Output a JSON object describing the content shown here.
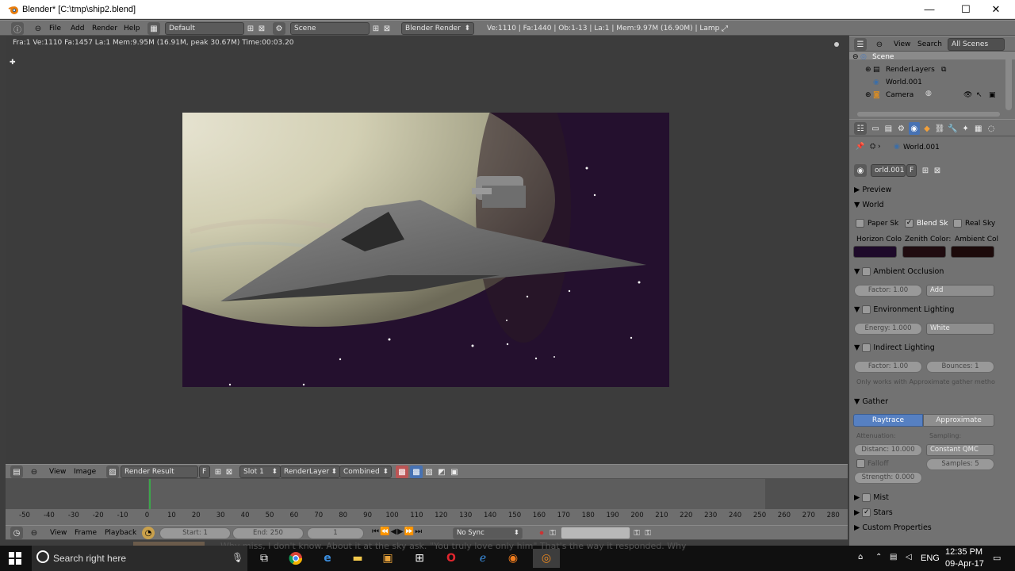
{
  "window": {
    "title": "Blender* [C:\\tmp\\ship2.blend]",
    "minimize": "—",
    "maximize": "☐",
    "close": "✕"
  },
  "info_header": {
    "menus": [
      "File",
      "Add",
      "Render",
      "Help"
    ],
    "layout": "Default",
    "scene": "Scene",
    "engine": "Blender Render",
    "stats": "Ve:1110 | Fa:1440 | Ob:1-13 | La:1 | Mem:9.97M (16.90M) | Lamp"
  },
  "viewport": {
    "render_stats": "Fra:1  Ve:1110 Fa:1457 La:1 Mem:9.95M (16.91M, peak 30.67M) Time:00:03.20"
  },
  "image_header": {
    "view": "View",
    "image": "Image",
    "image_name": "Render Result",
    "fake_user": "F",
    "slot": "Slot 1",
    "layer": "RenderLayer",
    "pass": "Combined"
  },
  "timeline": {
    "ticks": [
      "-50",
      "-40",
      "-30",
      "-20",
      "-10",
      "0",
      "10",
      "20",
      "30",
      "40",
      "50",
      "60",
      "70",
      "80",
      "90",
      "100",
      "110",
      "120",
      "130",
      "140",
      "150",
      "160",
      "170",
      "180",
      "190",
      "200",
      "210",
      "220",
      "230",
      "240",
      "250",
      "260",
      "270",
      "280"
    ],
    "current_frame_value": 1,
    "menus": [
      "View",
      "Frame",
      "Playback"
    ],
    "start": "Start: 1",
    "end": "End: 250",
    "frame": "1",
    "sync": "No Sync"
  },
  "outliner": {
    "view": "View",
    "search": "Search",
    "filter": "All Scenes",
    "items": [
      "Scene",
      "RenderLayers",
      "World.001",
      "Camera"
    ]
  },
  "properties": {
    "breadcrumb": "World.001",
    "datablock": "orld.001",
    "fake_user": "F",
    "preview": "Preview",
    "world": "World",
    "paper_sky": "Paper Sk",
    "blend_sky": "Blend Sk",
    "real_sky": "Real Sky",
    "horizon_label": "Horizon Colo",
    "zenith_label": "Zenith Color:",
    "ambient_label": "Ambient Col",
    "horizon_color": "#1e0a2a",
    "zenith_color": "#200c10",
    "ambient_color": "#1c0a0a",
    "ao": "Ambient Occlusion",
    "ao_factor": "Factor: 1.00",
    "ao_mode": "Add",
    "env": "Environment Lighting",
    "env_energy": "Energy: 1.000",
    "env_color": "White",
    "indirect": "Indirect Lighting",
    "ind_factor": "Factor: 1.00",
    "ind_bounces": "Bounces: 1",
    "ind_note": "Only works with Approximate gather metho",
    "gather": "Gather",
    "raytrace": "Raytrace",
    "approximate": "Approximate",
    "attenuation": "Attenuation:",
    "sampling": "Sampling:",
    "distance": "Distanc: 10.000",
    "constant_qmc": "Constant QMC",
    "falloff": "Falloff",
    "samples": "Samples: 5",
    "strength": "Strength: 0.000",
    "mist": "Mist",
    "stars": "Stars",
    "custom_props": "Custom Properties"
  },
  "taskbar": {
    "search_placeholder": "Search right here",
    "background_text": "Why miss, I don't know. About it at the sky ask. \"You truly love only him\" That's the way it responded. Why",
    "lang": "ENG",
    "time": "12:35 PM",
    "date": "09-Apr-17"
  }
}
